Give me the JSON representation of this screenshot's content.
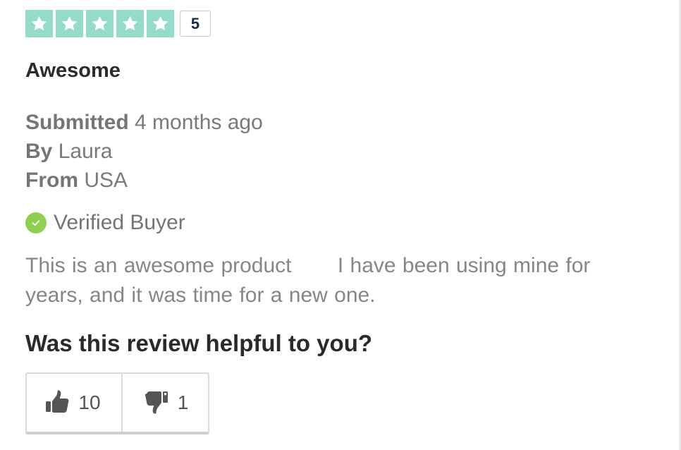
{
  "review": {
    "rating": {
      "stars": 5,
      "max_stars": 5,
      "score_label": "5",
      "star_color": "#94dcc9"
    },
    "title": "Awesome",
    "meta": {
      "submitted_label": "Submitted",
      "submitted_value": "4 months ago",
      "by_label": "By",
      "by_value": "Laura",
      "from_label": "From",
      "from_value": "USA"
    },
    "verified_label": "Verified Buyer",
    "verified_color": "#8fd14f",
    "body": "This is an awesome product       I have been using mine for years, and it was time for a new one.",
    "helpful": {
      "question": "Was this review helpful to you?",
      "upvote_count": "10",
      "downvote_count": "1",
      "upvote_icon": "thumbs-up-icon",
      "downvote_icon": "thumbs-down-icon"
    }
  }
}
